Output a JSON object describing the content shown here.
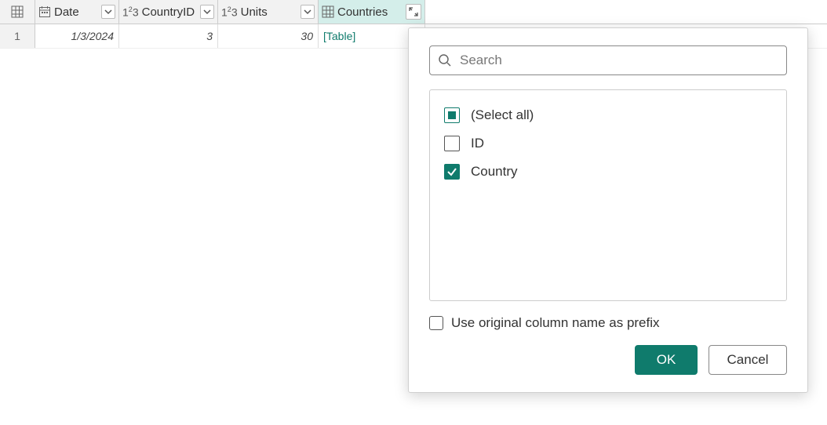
{
  "columns": {
    "date": {
      "label": "Date"
    },
    "countryid": {
      "label": "CountryID"
    },
    "units": {
      "label": "Units"
    },
    "countries": {
      "label": "Countries"
    }
  },
  "rows": [
    {
      "num": "1",
      "date": "1/3/2024",
      "countryid": "3",
      "units": "30",
      "countries": "[Table]"
    }
  ],
  "flyout": {
    "search_placeholder": "Search",
    "select_all": "(Select all)",
    "items": {
      "id": "ID",
      "country": "Country"
    },
    "prefix_label": "Use original column name as prefix",
    "ok": "OK",
    "cancel": "Cancel"
  }
}
